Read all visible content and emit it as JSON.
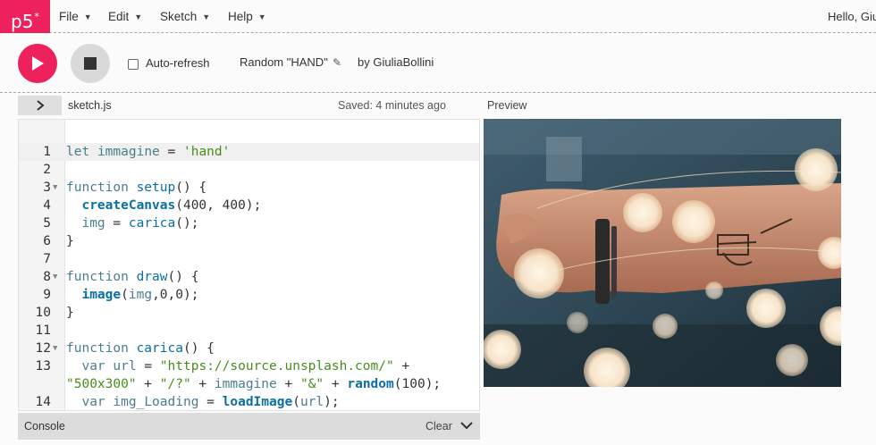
{
  "nav": {
    "logo": "p5",
    "logo_sup": "*",
    "menus": [
      {
        "label": "File"
      },
      {
        "label": "Edit"
      },
      {
        "label": "Sketch"
      },
      {
        "label": "Help"
      }
    ],
    "greeting": "Hello, Giu"
  },
  "toolbar": {
    "auto_refresh_label": "Auto-refresh",
    "auto_refresh_checked": false,
    "project_name": "Random \"HAND\"",
    "byline": "by GiuliaBollini"
  },
  "editor": {
    "filename": "sketch.js",
    "saved_status": "Saved: 4 minutes ago",
    "active_line": 1,
    "lines": [
      {
        "n": "1",
        "fold": "",
        "text": "let immagine = 'hand'"
      },
      {
        "n": "2",
        "fold": "",
        "text": ""
      },
      {
        "n": "3",
        "fold": "▼",
        "text": "function setup() {"
      },
      {
        "n": "4",
        "fold": "",
        "text": "  createCanvas(400, 400);"
      },
      {
        "n": "5",
        "fold": "",
        "text": "  img = carica();"
      },
      {
        "n": "6",
        "fold": "",
        "text": "}"
      },
      {
        "n": "7",
        "fold": "",
        "text": ""
      },
      {
        "n": "8",
        "fold": "▼",
        "text": "function draw() {"
      },
      {
        "n": "9",
        "fold": "",
        "text": "  image(img,0,0);"
      },
      {
        "n": "10",
        "fold": "",
        "text": "}"
      },
      {
        "n": "11",
        "fold": "",
        "text": ""
      },
      {
        "n": "12",
        "fold": "▼",
        "text": "function carica() {"
      },
      {
        "n": "13",
        "fold": "",
        "text": "  var url = \"https://source.unsplash.com/\" +"
      },
      {
        "n": "",
        "fold": "",
        "text": "\"500x300\" + \"/?\" + immagine + \"&\" + random(100);"
      },
      {
        "n": "14",
        "fold": "",
        "text": "  var img_Loading = loadImage(url);"
      }
    ]
  },
  "preview": {
    "label": "Preview"
  },
  "console": {
    "title": "Console",
    "clear_label": "Clear"
  },
  "colors": {
    "accent": "#ed225d",
    "keyword": "#4a7e8f",
    "function": "#0b6fa0",
    "string": "#478d1e"
  },
  "icons": {
    "play": "play-icon",
    "stop": "stop-icon",
    "pencil": "pencil-icon",
    "toggle": "chevron-right-icon",
    "console_collapse": "chevron-down-icon"
  }
}
